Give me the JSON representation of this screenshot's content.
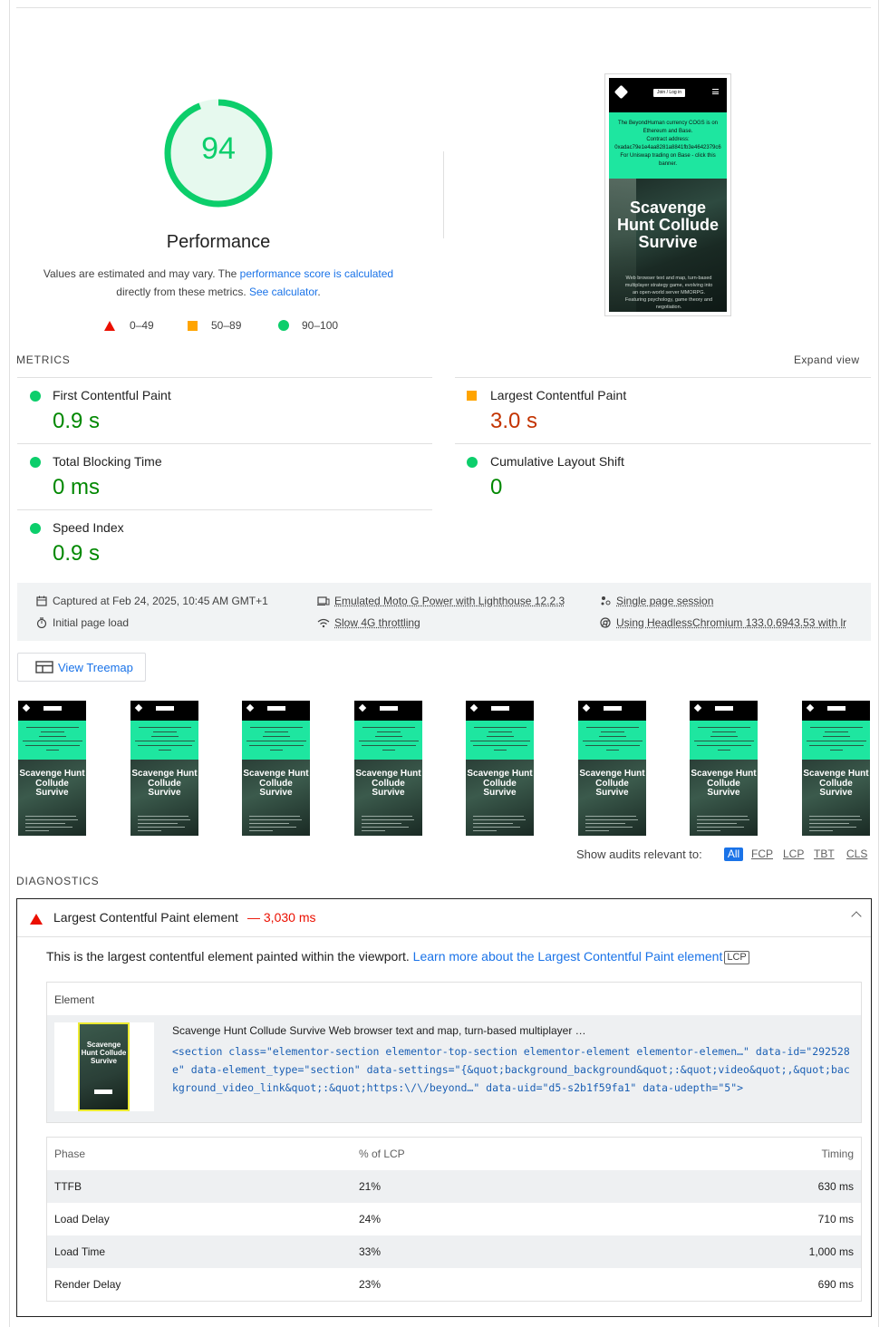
{
  "gauge": {
    "score": "94",
    "score_fraction": 0.94,
    "color": "#0cce6b"
  },
  "performance": {
    "title": "Performance",
    "desc_prefix": "Values are estimated and may vary. The ",
    "desc_link1": "performance score is calculated",
    "desc_mid": "directly from these metrics. ",
    "desc_link2": "See calculator",
    "desc_suffix": "."
  },
  "legend": {
    "fail": "0–49",
    "average": "50–89",
    "pass": "90–100"
  },
  "screenshot": {
    "header_button": "Join / Log in",
    "banner_lines": [
      "The BeyondHuman currency COGS is on",
      "Ethereum and Base.",
      "Contract address:",
      "0xadac79e1e4aa8281a8841fb3e4642379c6",
      "For Uniswap trading on Base - click this",
      "banner."
    ],
    "hero_title": "Scavenge Hunt Collude Survive",
    "hero_sub": "Web browser text and map, turn-based multiplayer strategy game, evolving into an open-world server MMORPG. Featuring psychology, game theory and negotiation."
  },
  "metrics": {
    "label": "METRICS",
    "expand": "Expand view",
    "items": [
      {
        "name": "First Contentful Paint",
        "value": "0.9 s",
        "status": "pass"
      },
      {
        "name": "Largest Contentful Paint",
        "value": "3.0 s",
        "status": "average"
      },
      {
        "name": "Total Blocking Time",
        "value": "0 ms",
        "status": "pass"
      },
      {
        "name": "Cumulative Layout Shift",
        "value": "0",
        "status": "pass"
      },
      {
        "name": "Speed Index",
        "value": "0.9 s",
        "status": "pass"
      }
    ]
  },
  "runtime": {
    "captured": "Captured at Feb 24, 2025, 10:45 AM GMT+1",
    "initial": "Initial page load",
    "device": "Emulated Moto G Power with Lighthouse 12.2.3",
    "throttling": "Slow 4G throttling",
    "session": "Single page session",
    "browser": "Using HeadlessChromium 133.0.6943.53 with lr"
  },
  "treemap": {
    "label": "View Treemap"
  },
  "filmstrip": {
    "frame_title": "Scavenge Hunt Collude Survive",
    "count": 8
  },
  "filter": {
    "label": "Show audits relevant to:",
    "chips": [
      "All",
      "FCP",
      "LCP",
      "TBT",
      "CLS"
    ]
  },
  "diagnostics": {
    "label": "DIAGNOSTICS",
    "audit_title": "Largest Contentful Paint element",
    "audit_value": "— 3,030 ms",
    "desc": "This is the largest contentful element painted within the viewport. ",
    "desc_link": "Learn more about the Largest Contentful Paint element",
    "desc_tag": "LCP",
    "element_header": "Element",
    "element_thumb_title": "Scavenge Hunt Collude Survive",
    "element_text": "Scavenge Hunt Collude Survive Web browser text and map, turn-based multiplayer …",
    "element_code": "<section class=\"elementor-section elementor-top-section elementor-element elementor-elemen…\" data-id=\"292528e\" data-element_type=\"section\" data-settings=\"{&quot;background_background&quot;:&quot;video&quot;,&quot;background_video_link&quot;:&quot;https:\\/\\/beyond…\" data-uid=\"d5-s2b1f59fa1\" data-udepth=\"5\">",
    "phase_table": {
      "headers": [
        "Phase",
        "% of LCP",
        "Timing"
      ],
      "rows": [
        [
          "TTFB",
          "21%",
          "630 ms"
        ],
        [
          "Load Delay",
          "24%",
          "710 ms"
        ],
        [
          "Load Time",
          "33%",
          "1,000 ms"
        ],
        [
          "Render Delay",
          "23%",
          "690 ms"
        ]
      ]
    }
  }
}
